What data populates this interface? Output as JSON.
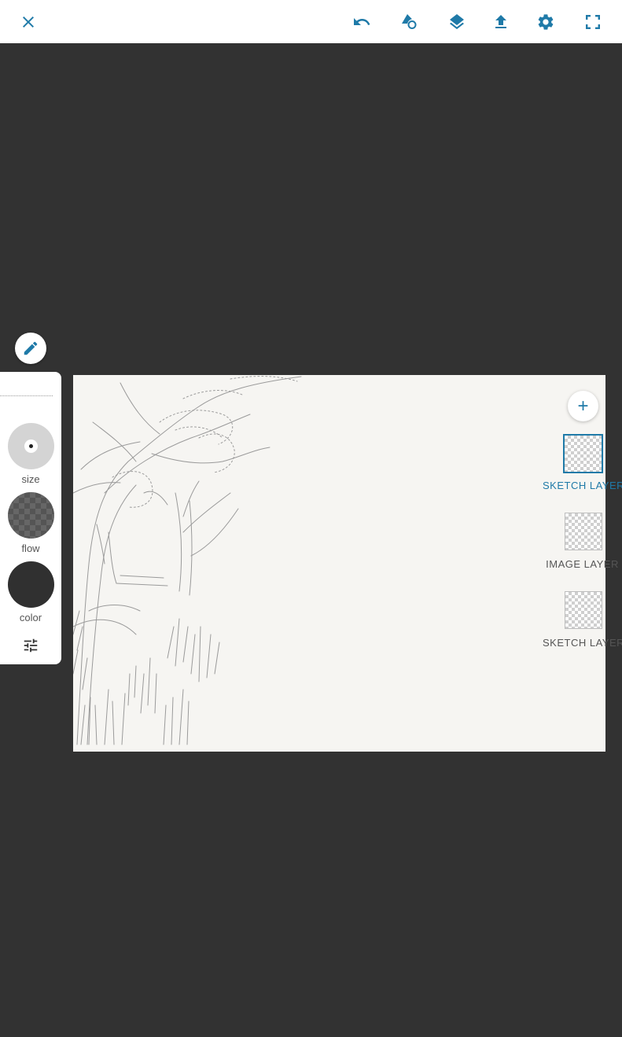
{
  "toolbar": {
    "close_icon": "close-icon",
    "undo_icon": "undo-icon",
    "shapes_icon": "shapes-icon",
    "layers_icon": "layers-icon",
    "export_icon": "upload-icon",
    "settings_icon": "gear-icon",
    "fullscreen_icon": "fullscreen-icon"
  },
  "brush_tools": {
    "size_label": "size",
    "flow_label": "flow",
    "color_label": "color"
  },
  "layers": {
    "add_symbol": "+",
    "items": [
      {
        "label": "SKETCH LAYER",
        "active": true
      },
      {
        "label": "IMAGE LAYER",
        "active": false
      },
      {
        "label": "SKETCH LAYER",
        "active": false
      }
    ]
  },
  "colors": {
    "accent": "#1f7aa8",
    "workspace": "#323232",
    "canvas": "#f6f5f2"
  }
}
